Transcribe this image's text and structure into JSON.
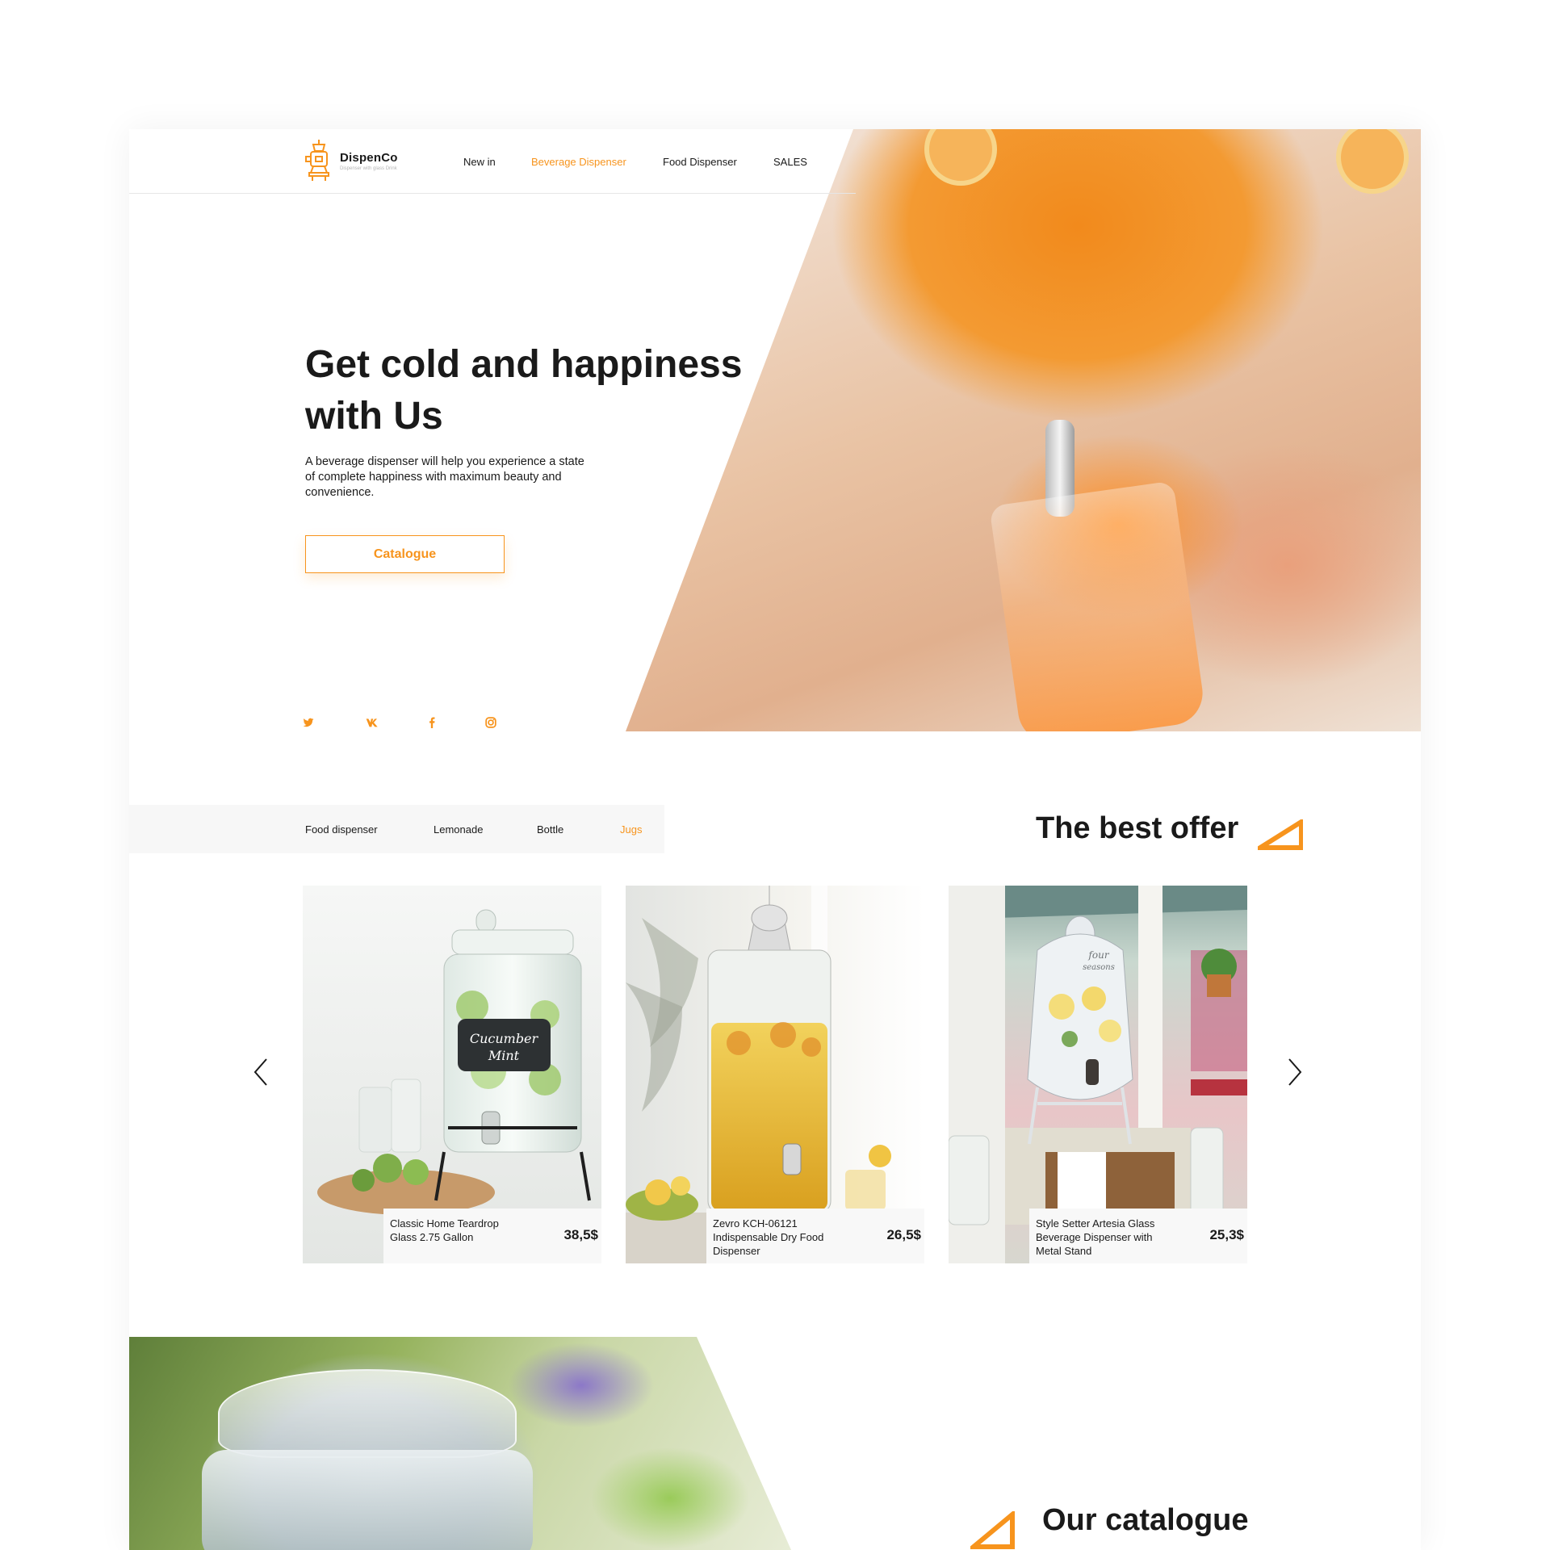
{
  "header": {
    "brand": "DispenCo",
    "tagline": "Dispenser with glass Drink",
    "nav": [
      {
        "label": "New in",
        "active": false
      },
      {
        "label": "Beverage Dispenser",
        "active": true
      },
      {
        "label": "Food Dispenser",
        "active": false
      },
      {
        "label": "SALES",
        "active": false
      }
    ]
  },
  "hero": {
    "title_line1": "Get cold and happiness",
    "title_line2": "with Us",
    "text_line1": "A beverage dispenser will help you experience a state",
    "text_line2": "of complete happiness with maximum beauty and",
    "text_line3": "convenience.",
    "button": "Catalogue"
  },
  "social": [
    {
      "icon": "twitter-icon",
      "glyph": "🐦"
    },
    {
      "icon": "vk-icon",
      "glyph": "vk"
    },
    {
      "icon": "facebook-icon",
      "glyph": "f"
    },
    {
      "icon": "instagram-icon",
      "glyph": "◎"
    }
  ],
  "filters": {
    "tabs": [
      {
        "label": "Food dispenser",
        "active": false
      },
      {
        "label": "Lemonade",
        "active": false
      },
      {
        "label": "Bottle",
        "active": false
      },
      {
        "label": "Jugs",
        "active": true
      }
    ]
  },
  "best_offer": {
    "title": "The best offer",
    "products": [
      {
        "name_line1": "Classic Home Teardrop",
        "name_line2": "Glass 2.75 Gallon",
        "name_line3": "",
        "price": "38,5$"
      },
      {
        "name_line1": "Zevro KCH-06121",
        "name_line2": "Indispensable Dry Food",
        "name_line3": "Dispenser",
        "price": "26,5$"
      },
      {
        "name_line1": "Style Setter Artesia Glass",
        "name_line2": "Beverage Dispenser with",
        "name_line3": "Metal Stand",
        "price": "25,3$"
      }
    ],
    "prev_icon": "chevron-left-icon",
    "next_icon": "chevron-right-icon"
  },
  "catalogue_section": {
    "title": "Our catalogue"
  },
  "colors": {
    "accent": "#f7941d",
    "text": "#1a1a1a",
    "tab_bar": "#f7f7f7"
  }
}
